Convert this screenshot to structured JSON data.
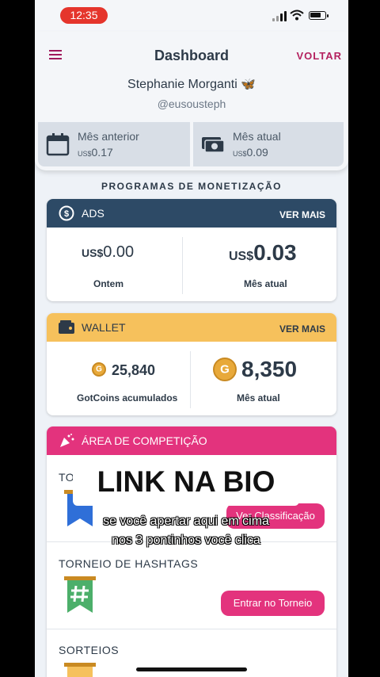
{
  "status_bar": {
    "time": "12:35"
  },
  "header": {
    "title": "Dashboard",
    "back_label": "VOLTAR",
    "user_name": "Stephanie Morganti",
    "user_emoji": "🦋",
    "handle": "@eusousteph"
  },
  "earnings": {
    "previous": {
      "label": "Mês anterior",
      "currency": "US$",
      "value": "0.17",
      "icon": "calendar-icon"
    },
    "current": {
      "label": "Mês atual",
      "currency": "US$",
      "value": "0.09",
      "icon": "money-icon"
    }
  },
  "section_title": "PROGRAMAS DE MONETIZAÇÃO",
  "ads": {
    "title": "ADS",
    "more": "VER MAIS",
    "yesterday": {
      "currency": "US$",
      "value": "0.00",
      "label": "Ontem"
    },
    "month": {
      "currency": "US$",
      "value": "0.03",
      "label": "Mês atual"
    }
  },
  "wallet": {
    "title": "WALLET",
    "more": "VER MAIS",
    "accumulated": {
      "value": "25,840",
      "label": "GotCoins acumulados"
    },
    "month": {
      "value": "8,350",
      "label": "Mês atual"
    }
  },
  "competition": {
    "title": "ÁREA DE COMPETIÇÃO",
    "rows": [
      {
        "title": "TO",
        "button": "Ver Classificação"
      },
      {
        "title": "TORNEIO DE HASHTAGS",
        "button": "Entrar no Torneio"
      },
      {
        "title": "SORTEIOS",
        "button": ""
      }
    ]
  },
  "overlay": {
    "link_bio": "LINK NA BIO",
    "caption_line1": "se você apertar aqui em cima",
    "caption_line2": "nos 3 pontinhos você clica"
  },
  "colors": {
    "ads_header": "#2d4a66",
    "wallet_header": "#f6c15c",
    "competition_header": "#e3337d",
    "accent": "#b4215f"
  }
}
